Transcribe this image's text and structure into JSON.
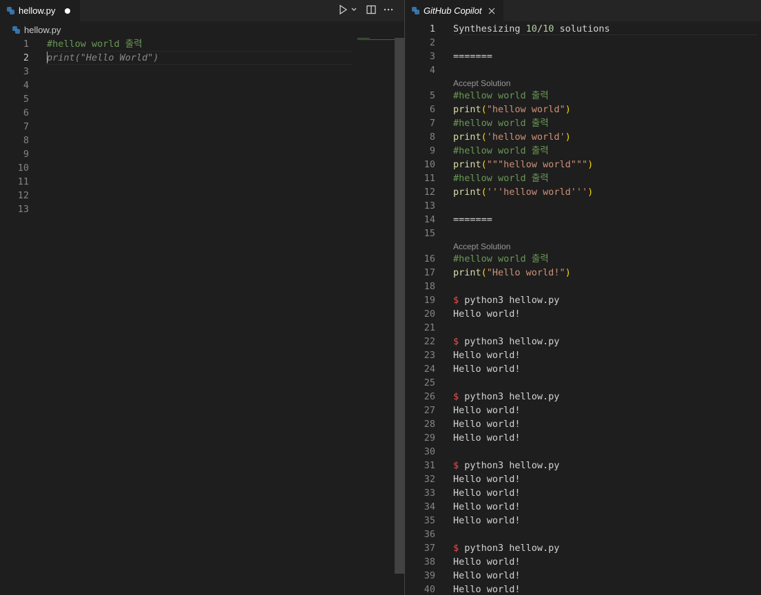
{
  "left_editor": {
    "tab": {
      "label": "hellow.py",
      "modified": true
    },
    "toolbar": {
      "run_icon": "play-icon",
      "run_dropdown_icon": "chevron-down-icon",
      "split_icon": "split-editor-icon",
      "more_icon": "ellipsis-icon"
    },
    "breadcrumb": {
      "file": "hellow.py"
    },
    "line_numbers": [
      "1",
      "2",
      "3",
      "4",
      "5",
      "6",
      "7",
      "8",
      "9",
      "10",
      "11",
      "12",
      "13"
    ],
    "current_line": "2",
    "lines": [
      {
        "comment": "#hellow world 출력"
      },
      {
        "ghost": "print(\"Hello World\")"
      }
    ]
  },
  "right_editor": {
    "tab": {
      "label": "GitHub Copilot",
      "close_icon": "close-icon"
    },
    "header": {
      "prefix": "Synthesizing ",
      "current": "10",
      "sep": "/",
      "total": "10",
      "suffix": " solutions"
    },
    "separator": "=======",
    "accept_label": "Accept Solution",
    "line_numbers": [
      "1",
      "2",
      "3",
      "4",
      "5",
      "6",
      "7",
      "8",
      "9",
      "10",
      "11",
      "12",
      "13",
      "14",
      "15",
      "16",
      "17",
      "18",
      "19",
      "20",
      "21",
      "22",
      "23",
      "24",
      "25",
      "26",
      "27",
      "28",
      "29",
      "30",
      "31",
      "32",
      "33",
      "34",
      "35",
      "36",
      "37",
      "38",
      "39",
      "40"
    ],
    "solution1": [
      {
        "comment": "#hellow world 출력"
      },
      {
        "fn": "print",
        "str": "\"hellow world\""
      },
      {
        "comment": "#hellow world 출력"
      },
      {
        "fn": "print",
        "str": "'hellow world'"
      },
      {
        "comment": "#hellow world 출력"
      },
      {
        "fn": "print",
        "str": "\"\"\"hellow world\"\"\""
      },
      {
        "comment": "#hellow world 출력"
      },
      {
        "fn": "print",
        "str": "'''hellow world'''"
      }
    ],
    "solution2": [
      {
        "comment": "#hellow world 출력"
      },
      {
        "fn": "print",
        "str": "\"Hello world!\""
      }
    ],
    "prompt_symbol": "$",
    "command": " python3 hellow.py",
    "output": "Hello world!"
  },
  "colors": {
    "background": "#1e1e1e",
    "tabbar": "#252526",
    "comment": "#6a9955",
    "function": "#dcdcaa",
    "string": "#ce9178",
    "bracket": "#ffd700",
    "number": "#b5cea8",
    "prompt": "#f14c4c"
  }
}
